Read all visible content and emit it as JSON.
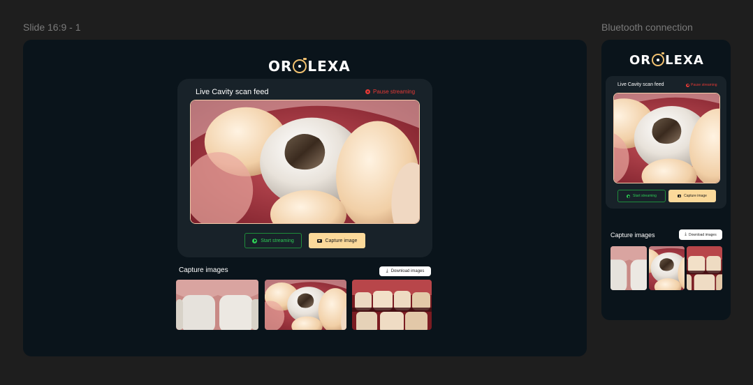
{
  "frames": {
    "main_label": "Slide 16:9 - 1",
    "side_label": "Bluetooth connection"
  },
  "logo": {
    "part1": "OR",
    "part2": "LEXA",
    "icon": "camera-lens-icon"
  },
  "feed": {
    "title": "Live Cavity scan feed",
    "pause_label": "Pause streaming",
    "pause_icon": "pause-circle-icon",
    "image_icon": "tooth-cavity-photo"
  },
  "controls": {
    "start_label": "Start streaming",
    "start_icon": "play-circle-icon",
    "capture_label": "Capture image",
    "capture_icon": "camera-icon"
  },
  "captures": {
    "title": "Capture images",
    "download_label": "Download images",
    "download_icon": "download-icon",
    "thumbnails": [
      "front-teeth-photo",
      "cavity-molar-photo",
      "teeth-gap-photo"
    ]
  },
  "colors": {
    "background": "#1e1e1e",
    "frame": "#0a141b",
    "card": "#182229",
    "accent_gold": "#fbd99a",
    "stream_green": "#2ecc55",
    "pause_red": "#e53935"
  }
}
